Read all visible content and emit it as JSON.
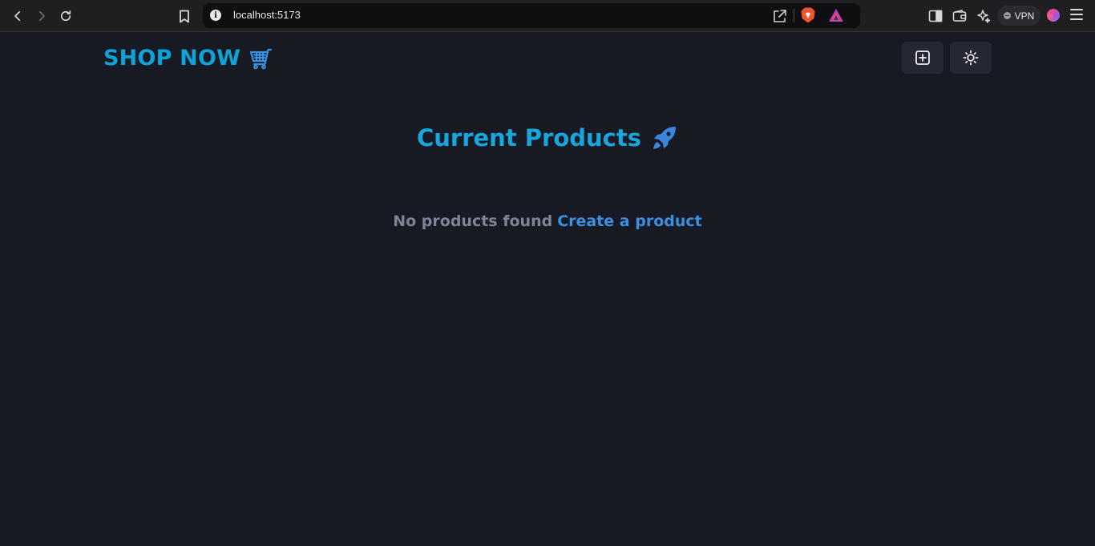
{
  "browser": {
    "url": "localhost:5173",
    "info_glyph": "i",
    "vpn_label": "VPN",
    "icons": {
      "back": "chevron-left-icon",
      "forward": "chevron-right-icon",
      "reload": "reload-icon",
      "bookmark": "bookmark-icon",
      "share": "share-icon",
      "shields": "brave-shields-icon",
      "rewards": "brave-rewards-icon",
      "sidebar": "sidebar-icon",
      "wallet": "wallet-icon",
      "leo": "leo-ai-icon",
      "menu": "hamburger-menu-icon"
    }
  },
  "navbar": {
    "brand": "SHOP NOW",
    "brand_color": "#0fa2d8",
    "create_button_icon": "plus-square-icon",
    "theme_button_icon": "sun-icon"
  },
  "main": {
    "heading": "Current Products",
    "heading_color": "#17a6dd",
    "empty_message": "No products found",
    "create_link": "Create a product",
    "link_color": "#3a8fe0"
  }
}
